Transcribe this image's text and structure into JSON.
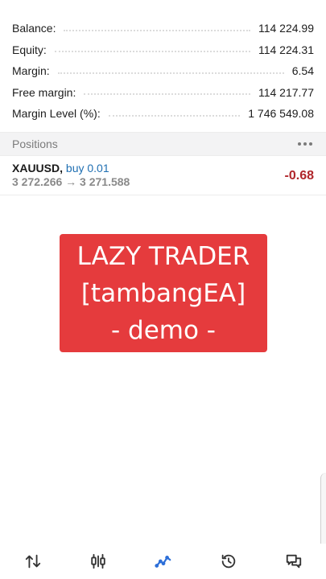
{
  "summary": [
    {
      "label": "Balance:",
      "value": "114 224.99"
    },
    {
      "label": "Equity:",
      "value": "114 224.31"
    },
    {
      "label": "Margin:",
      "value": "6.54"
    },
    {
      "label": "Free margin:",
      "value": "114 217.77"
    },
    {
      "label": "Margin Level (%):",
      "value": "1 746 549.08"
    }
  ],
  "positions": {
    "title": "Positions",
    "items": [
      {
        "symbol": "XAUUSD,",
        "direction": "buy 0.01",
        "prices": "3 272.266 → 3 271.588",
        "profit": "-0.68"
      }
    ]
  },
  "banner": {
    "line1": "LAZY TRADER",
    "line2": "[tambangEA]",
    "line3": "- demo -"
  },
  "nav": {
    "items": [
      {
        "icon": "quotes-icon"
      },
      {
        "icon": "chart-icon"
      },
      {
        "icon": "trade-icon",
        "active": true
      },
      {
        "icon": "history-icon"
      },
      {
        "icon": "messages-icon"
      }
    ]
  },
  "colors": {
    "accent": "#2d6fd8",
    "loss": "#b0262b",
    "banner": "#e53b3d",
    "direction": "#1f6fb2"
  }
}
